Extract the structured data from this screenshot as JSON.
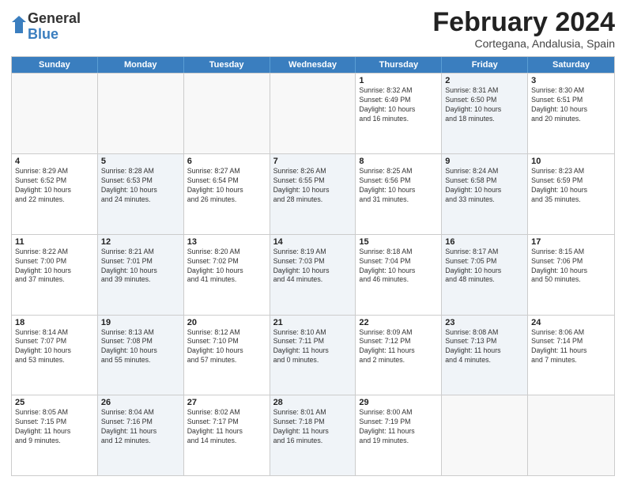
{
  "logo": {
    "general": "General",
    "blue": "Blue"
  },
  "title": "February 2024",
  "subtitle": "Cortegana, Andalusia, Spain",
  "header_days": [
    "Sunday",
    "Monday",
    "Tuesday",
    "Wednesday",
    "Thursday",
    "Friday",
    "Saturday"
  ],
  "rows": [
    [
      {
        "day": "",
        "info": "",
        "shaded": false,
        "empty": true
      },
      {
        "day": "",
        "info": "",
        "shaded": false,
        "empty": true
      },
      {
        "day": "",
        "info": "",
        "shaded": false,
        "empty": true
      },
      {
        "day": "",
        "info": "",
        "shaded": false,
        "empty": true
      },
      {
        "day": "1",
        "info": "Sunrise: 8:32 AM\nSunset: 6:49 PM\nDaylight: 10 hours\nand 16 minutes.",
        "shaded": false,
        "empty": false
      },
      {
        "day": "2",
        "info": "Sunrise: 8:31 AM\nSunset: 6:50 PM\nDaylight: 10 hours\nand 18 minutes.",
        "shaded": true,
        "empty": false
      },
      {
        "day": "3",
        "info": "Sunrise: 8:30 AM\nSunset: 6:51 PM\nDaylight: 10 hours\nand 20 minutes.",
        "shaded": false,
        "empty": false
      }
    ],
    [
      {
        "day": "4",
        "info": "Sunrise: 8:29 AM\nSunset: 6:52 PM\nDaylight: 10 hours\nand 22 minutes.",
        "shaded": false,
        "empty": false
      },
      {
        "day": "5",
        "info": "Sunrise: 8:28 AM\nSunset: 6:53 PM\nDaylight: 10 hours\nand 24 minutes.",
        "shaded": true,
        "empty": false
      },
      {
        "day": "6",
        "info": "Sunrise: 8:27 AM\nSunset: 6:54 PM\nDaylight: 10 hours\nand 26 minutes.",
        "shaded": false,
        "empty": false
      },
      {
        "day": "7",
        "info": "Sunrise: 8:26 AM\nSunset: 6:55 PM\nDaylight: 10 hours\nand 28 minutes.",
        "shaded": true,
        "empty": false
      },
      {
        "day": "8",
        "info": "Sunrise: 8:25 AM\nSunset: 6:56 PM\nDaylight: 10 hours\nand 31 minutes.",
        "shaded": false,
        "empty": false
      },
      {
        "day": "9",
        "info": "Sunrise: 8:24 AM\nSunset: 6:58 PM\nDaylight: 10 hours\nand 33 minutes.",
        "shaded": true,
        "empty": false
      },
      {
        "day": "10",
        "info": "Sunrise: 8:23 AM\nSunset: 6:59 PM\nDaylight: 10 hours\nand 35 minutes.",
        "shaded": false,
        "empty": false
      }
    ],
    [
      {
        "day": "11",
        "info": "Sunrise: 8:22 AM\nSunset: 7:00 PM\nDaylight: 10 hours\nand 37 minutes.",
        "shaded": false,
        "empty": false
      },
      {
        "day": "12",
        "info": "Sunrise: 8:21 AM\nSunset: 7:01 PM\nDaylight: 10 hours\nand 39 minutes.",
        "shaded": true,
        "empty": false
      },
      {
        "day": "13",
        "info": "Sunrise: 8:20 AM\nSunset: 7:02 PM\nDaylight: 10 hours\nand 41 minutes.",
        "shaded": false,
        "empty": false
      },
      {
        "day": "14",
        "info": "Sunrise: 8:19 AM\nSunset: 7:03 PM\nDaylight: 10 hours\nand 44 minutes.",
        "shaded": true,
        "empty": false
      },
      {
        "day": "15",
        "info": "Sunrise: 8:18 AM\nSunset: 7:04 PM\nDaylight: 10 hours\nand 46 minutes.",
        "shaded": false,
        "empty": false
      },
      {
        "day": "16",
        "info": "Sunrise: 8:17 AM\nSunset: 7:05 PM\nDaylight: 10 hours\nand 48 minutes.",
        "shaded": true,
        "empty": false
      },
      {
        "day": "17",
        "info": "Sunrise: 8:15 AM\nSunset: 7:06 PM\nDaylight: 10 hours\nand 50 minutes.",
        "shaded": false,
        "empty": false
      }
    ],
    [
      {
        "day": "18",
        "info": "Sunrise: 8:14 AM\nSunset: 7:07 PM\nDaylight: 10 hours\nand 53 minutes.",
        "shaded": false,
        "empty": false
      },
      {
        "day": "19",
        "info": "Sunrise: 8:13 AM\nSunset: 7:08 PM\nDaylight: 10 hours\nand 55 minutes.",
        "shaded": true,
        "empty": false
      },
      {
        "day": "20",
        "info": "Sunrise: 8:12 AM\nSunset: 7:10 PM\nDaylight: 10 hours\nand 57 minutes.",
        "shaded": false,
        "empty": false
      },
      {
        "day": "21",
        "info": "Sunrise: 8:10 AM\nSunset: 7:11 PM\nDaylight: 11 hours\nand 0 minutes.",
        "shaded": true,
        "empty": false
      },
      {
        "day": "22",
        "info": "Sunrise: 8:09 AM\nSunset: 7:12 PM\nDaylight: 11 hours\nand 2 minutes.",
        "shaded": false,
        "empty": false
      },
      {
        "day": "23",
        "info": "Sunrise: 8:08 AM\nSunset: 7:13 PM\nDaylight: 11 hours\nand 4 minutes.",
        "shaded": true,
        "empty": false
      },
      {
        "day": "24",
        "info": "Sunrise: 8:06 AM\nSunset: 7:14 PM\nDaylight: 11 hours\nand 7 minutes.",
        "shaded": false,
        "empty": false
      }
    ],
    [
      {
        "day": "25",
        "info": "Sunrise: 8:05 AM\nSunset: 7:15 PM\nDaylight: 11 hours\nand 9 minutes.",
        "shaded": false,
        "empty": false
      },
      {
        "day": "26",
        "info": "Sunrise: 8:04 AM\nSunset: 7:16 PM\nDaylight: 11 hours\nand 12 minutes.",
        "shaded": true,
        "empty": false
      },
      {
        "day": "27",
        "info": "Sunrise: 8:02 AM\nSunset: 7:17 PM\nDaylight: 11 hours\nand 14 minutes.",
        "shaded": false,
        "empty": false
      },
      {
        "day": "28",
        "info": "Sunrise: 8:01 AM\nSunset: 7:18 PM\nDaylight: 11 hours\nand 16 minutes.",
        "shaded": true,
        "empty": false
      },
      {
        "day": "29",
        "info": "Sunrise: 8:00 AM\nSunset: 7:19 PM\nDaylight: 11 hours\nand 19 minutes.",
        "shaded": false,
        "empty": false
      },
      {
        "day": "",
        "info": "",
        "shaded": false,
        "empty": true
      },
      {
        "day": "",
        "info": "",
        "shaded": false,
        "empty": true
      }
    ]
  ]
}
